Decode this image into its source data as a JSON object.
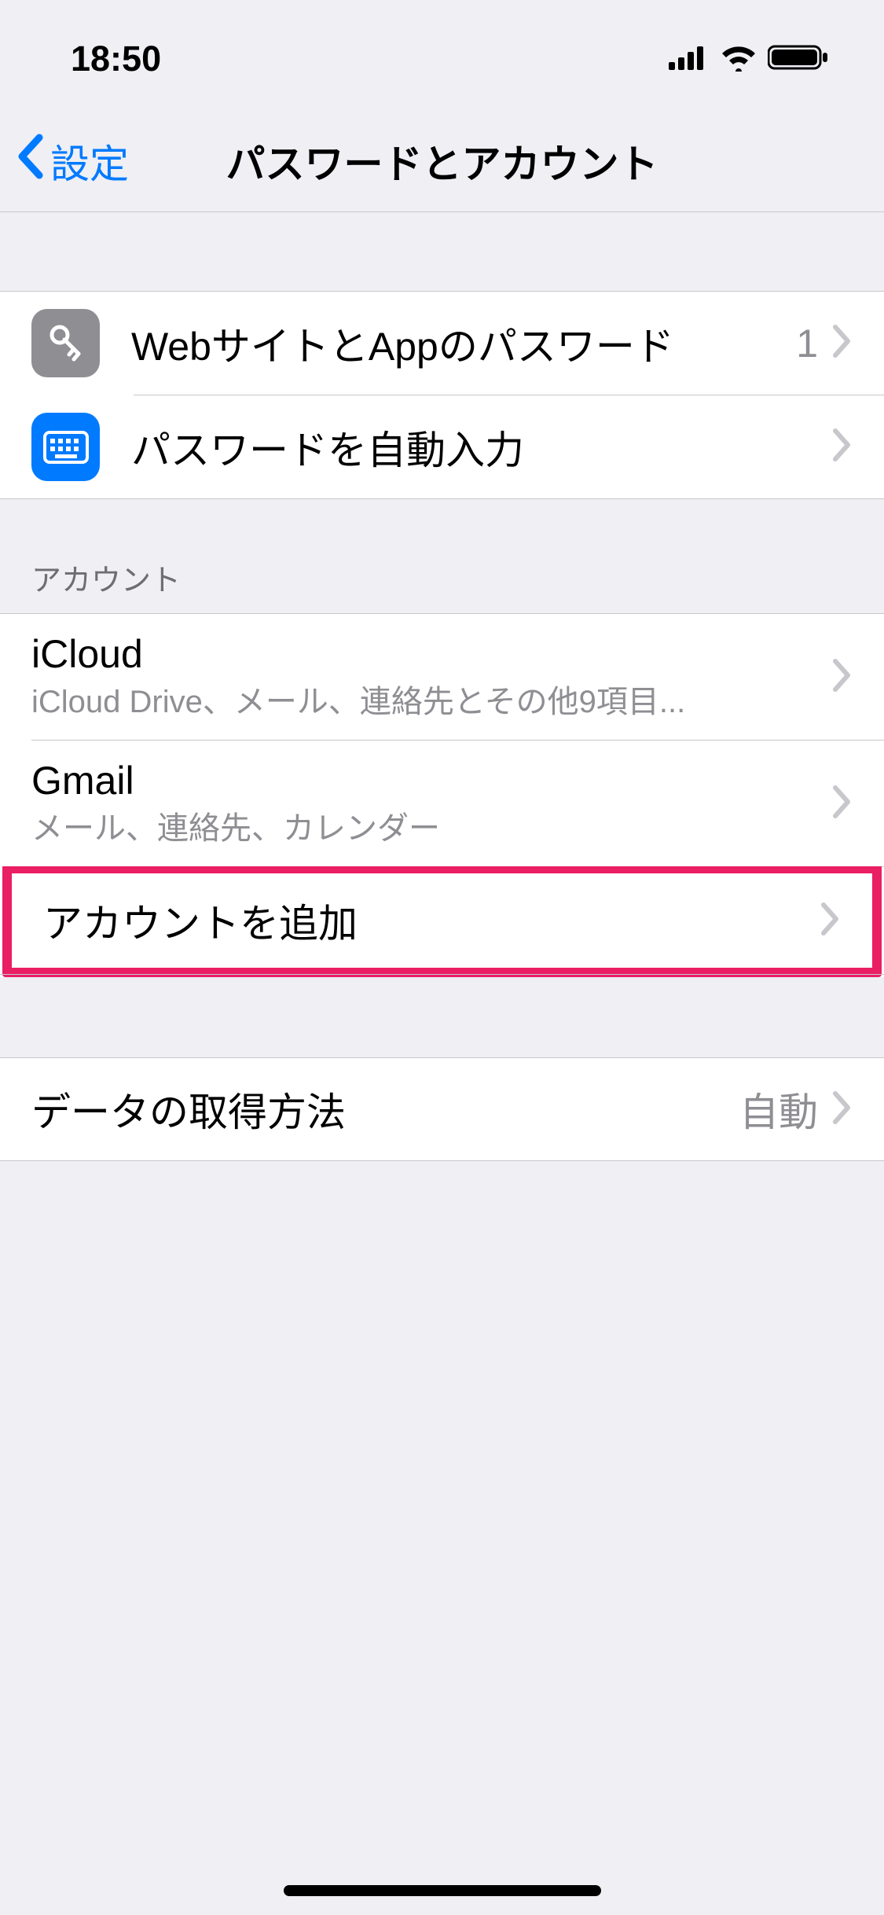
{
  "status": {
    "time": "18:50"
  },
  "nav": {
    "back": "設定",
    "title": "パスワードとアカウント"
  },
  "passwords_section": {
    "items": [
      {
        "label": "WebサイトとAppのパスワード",
        "value": "1"
      },
      {
        "label": "パスワードを自動入力"
      }
    ]
  },
  "accounts_section": {
    "header": "アカウント",
    "items": [
      {
        "label": "iCloud",
        "sub": "iCloud Drive、メール、連絡先とその他9項目..."
      },
      {
        "label": "Gmail",
        "sub": "メール、連絡先、カレンダー"
      },
      {
        "label": "アカウントを追加"
      }
    ]
  },
  "fetch_section": {
    "items": [
      {
        "label": "データの取得方法",
        "value": "自動"
      }
    ]
  }
}
